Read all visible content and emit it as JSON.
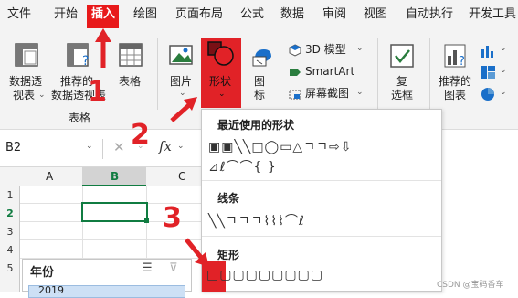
{
  "menu": {
    "items": [
      "文件",
      "开始",
      "插入",
      "绘图",
      "页面布局",
      "公式",
      "数据",
      "审阅",
      "视图",
      "自动执行",
      "开发工具"
    ],
    "active": "插入"
  },
  "ribbon": {
    "pivot_table": "数据透视表",
    "pivot_line1": "数据透",
    "pivot_line2": "视表",
    "rec_pivot_line1": "推荐的",
    "rec_pivot_line2": "数据透视表",
    "table": "表格",
    "group_tables": "表格",
    "picture": "图片",
    "shapes": "形状",
    "icons": "图标",
    "model3d": "3D 模型",
    "smartart": "SmartArt",
    "screenshot": "屏幕截图",
    "checkbox_line1": "复",
    "checkbox_line2": "选框",
    "rec_chart_line1": "推荐的",
    "rec_chart_line2": "图表"
  },
  "formula": {
    "name_box": "B2",
    "fx": "fx"
  },
  "grid": {
    "columns": [
      "A",
      "B",
      "C"
    ],
    "rows": [
      "1",
      "2",
      "3",
      "4",
      "5"
    ]
  },
  "shapes_menu": {
    "recent_title": "最近使用的形状",
    "recent_row1": "▣▣╲╲□◯▭△ㄱㄱ⇨⇩",
    "recent_row2": "⊿ℓ⌒⌒{ }",
    "lines_title": "线条",
    "lines_row": "╲╲ㄱㄱㄱ⌇⌇⌇⌒ℓ",
    "rect_title": "矩形",
    "rect_row": "□▢▢▢▢▢▢▢▢"
  },
  "slicer": {
    "title": "年份",
    "first_item": "2019"
  },
  "annotations": [
    "1",
    "2",
    "3"
  ],
  "watermark": "CSDN @宝码香车",
  "colors": {
    "highlight": "#e12227",
    "ribbon_bg": "#f3f3f3",
    "selection": "#107c41"
  }
}
